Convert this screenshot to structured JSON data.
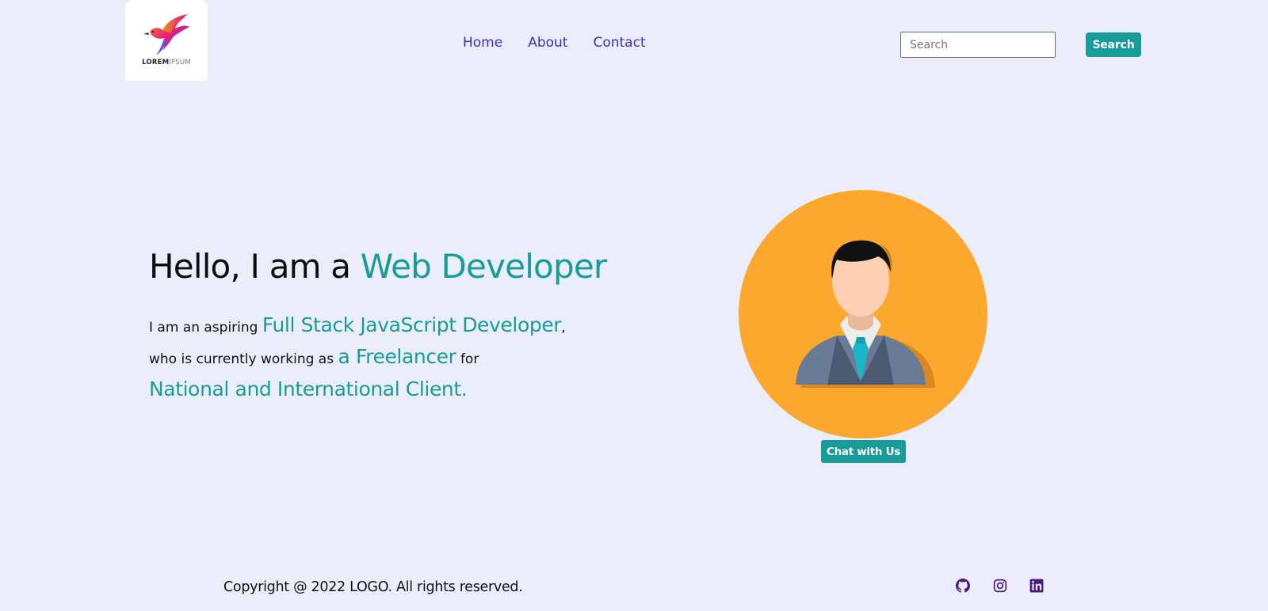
{
  "logo": {
    "text_bold": "LOREM",
    "text_light": "IPSUM"
  },
  "nav": {
    "items": [
      {
        "label": "Home"
      },
      {
        "label": "About"
      },
      {
        "label": "Contact"
      }
    ]
  },
  "search": {
    "placeholder": "Search",
    "button_label": "Search"
  },
  "hero": {
    "title_prefix": "Hello, I am a ",
    "title_accent": "Web Developer",
    "line1_prefix": "I am an aspiring ",
    "line1_accent": "Full Stack JavaScript Developer",
    "line1_suffix": ",",
    "line2_prefix": "who is currently working as ",
    "line2_accent": "a Freelancer",
    "line2_suffix": " for",
    "line3": "National and International Client."
  },
  "chat": {
    "button_label": "Chat with Us"
  },
  "footer": {
    "copyright": "Copyright @ 2022 LOGO. All rights reserved."
  },
  "social": {
    "icons": [
      "github-icon",
      "instagram-icon",
      "linkedin-icon"
    ]
  },
  "colors": {
    "background": "#ebeefa",
    "accent": "#189c9a",
    "nav_link": "#3b2fbf",
    "avatar_bg": "#fca82e",
    "social_icon": "#4a1d7a"
  }
}
